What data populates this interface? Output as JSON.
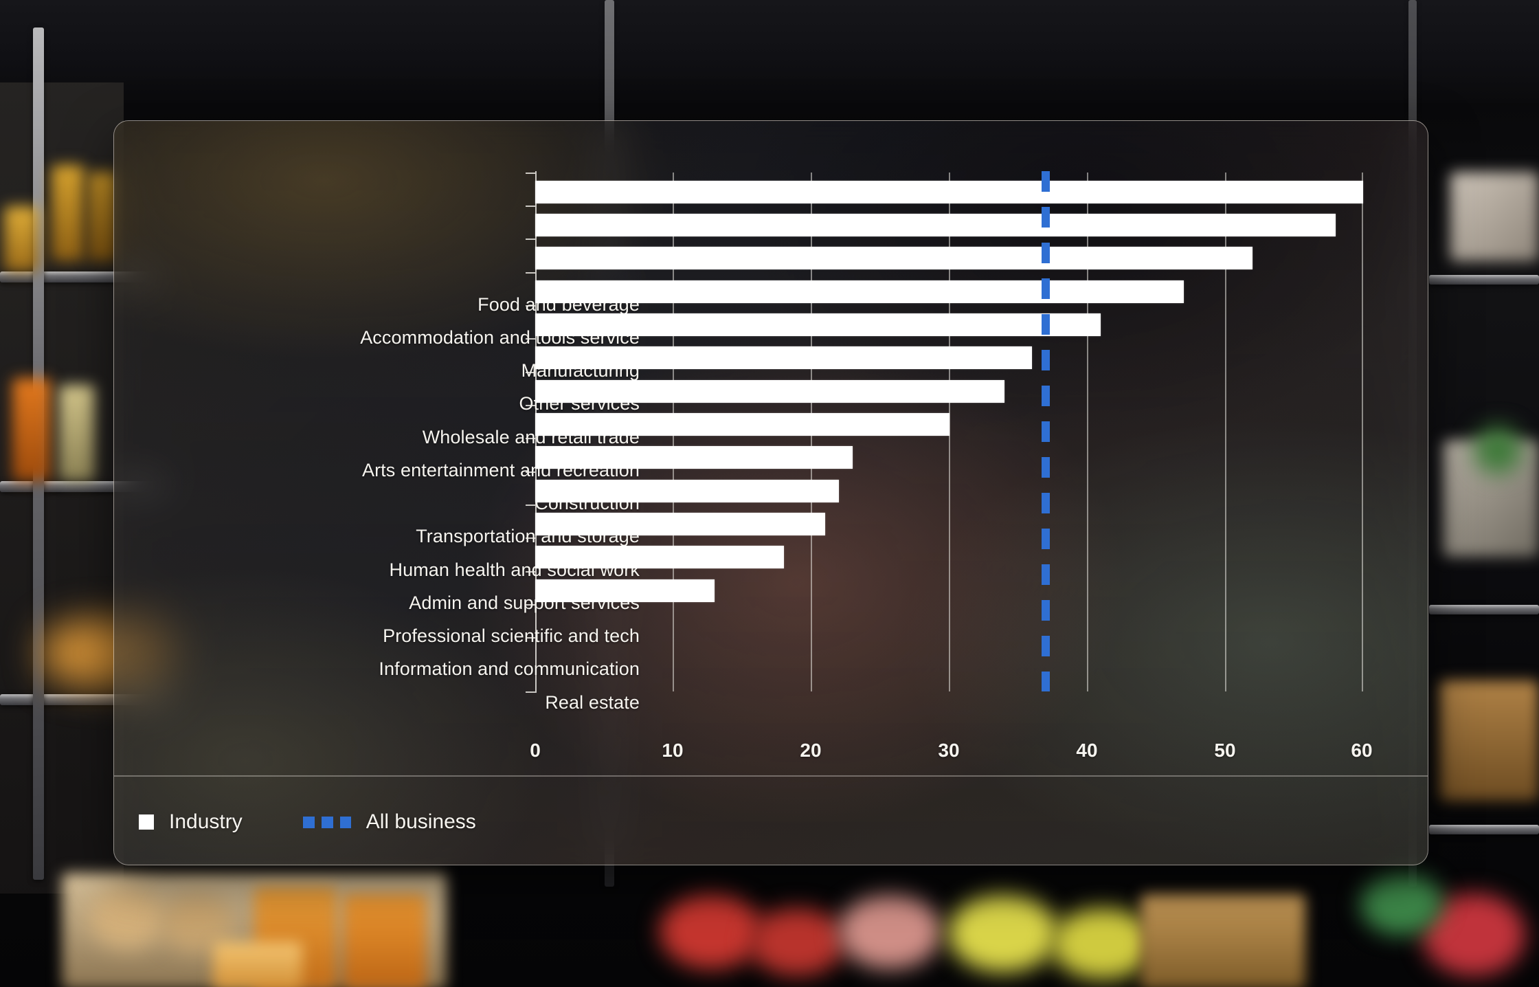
{
  "chart_data": {
    "type": "bar",
    "orientation": "horizontal",
    "title": "",
    "xlabel": "",
    "ylabel": "",
    "xlim": [
      0,
      60
    ],
    "xticks": [
      0,
      10,
      20,
      30,
      40,
      50,
      60
    ],
    "xtick_labels": [
      "0",
      "10",
      "20",
      "30",
      "40",
      "50",
      "60"
    ],
    "grid": true,
    "grid_axis": "x",
    "categories": [
      "Food and beverage",
      "Accommodation and tools service",
      "Manufacturing",
      "Other services",
      "Wholesale and retail trade",
      "Arts entertainment and recreation",
      "Construction",
      "Transportation and storage",
      "Human health and social work",
      "Admin and support services",
      "Professional scientific and tech",
      "Information and communication",
      "Real estate"
    ],
    "series": [
      {
        "name": "Industry",
        "type": "bar",
        "color": "#ffffff",
        "values": [
          60,
          58,
          52,
          47,
          41,
          36,
          34,
          30,
          23,
          22,
          21,
          18,
          13
        ]
      },
      {
        "name": "All business",
        "type": "reference-line",
        "style": "dashed",
        "color": "#2f6fd3",
        "value": 37
      }
    ],
    "legend": {
      "position": "bottom-left",
      "entries": [
        {
          "label": "Industry",
          "marker": "square",
          "color": "#ffffff"
        },
        {
          "label": "All business",
          "marker": "dashed-line",
          "color": "#2f6fd3"
        }
      ]
    }
  },
  "card": {
    "background_style": "frosted-glass-over-photo"
  },
  "colors": {
    "bar": "#ffffff",
    "benchmark": "#2f6fd3",
    "text": "#f6f4ef",
    "grid": "#f0eee8"
  }
}
